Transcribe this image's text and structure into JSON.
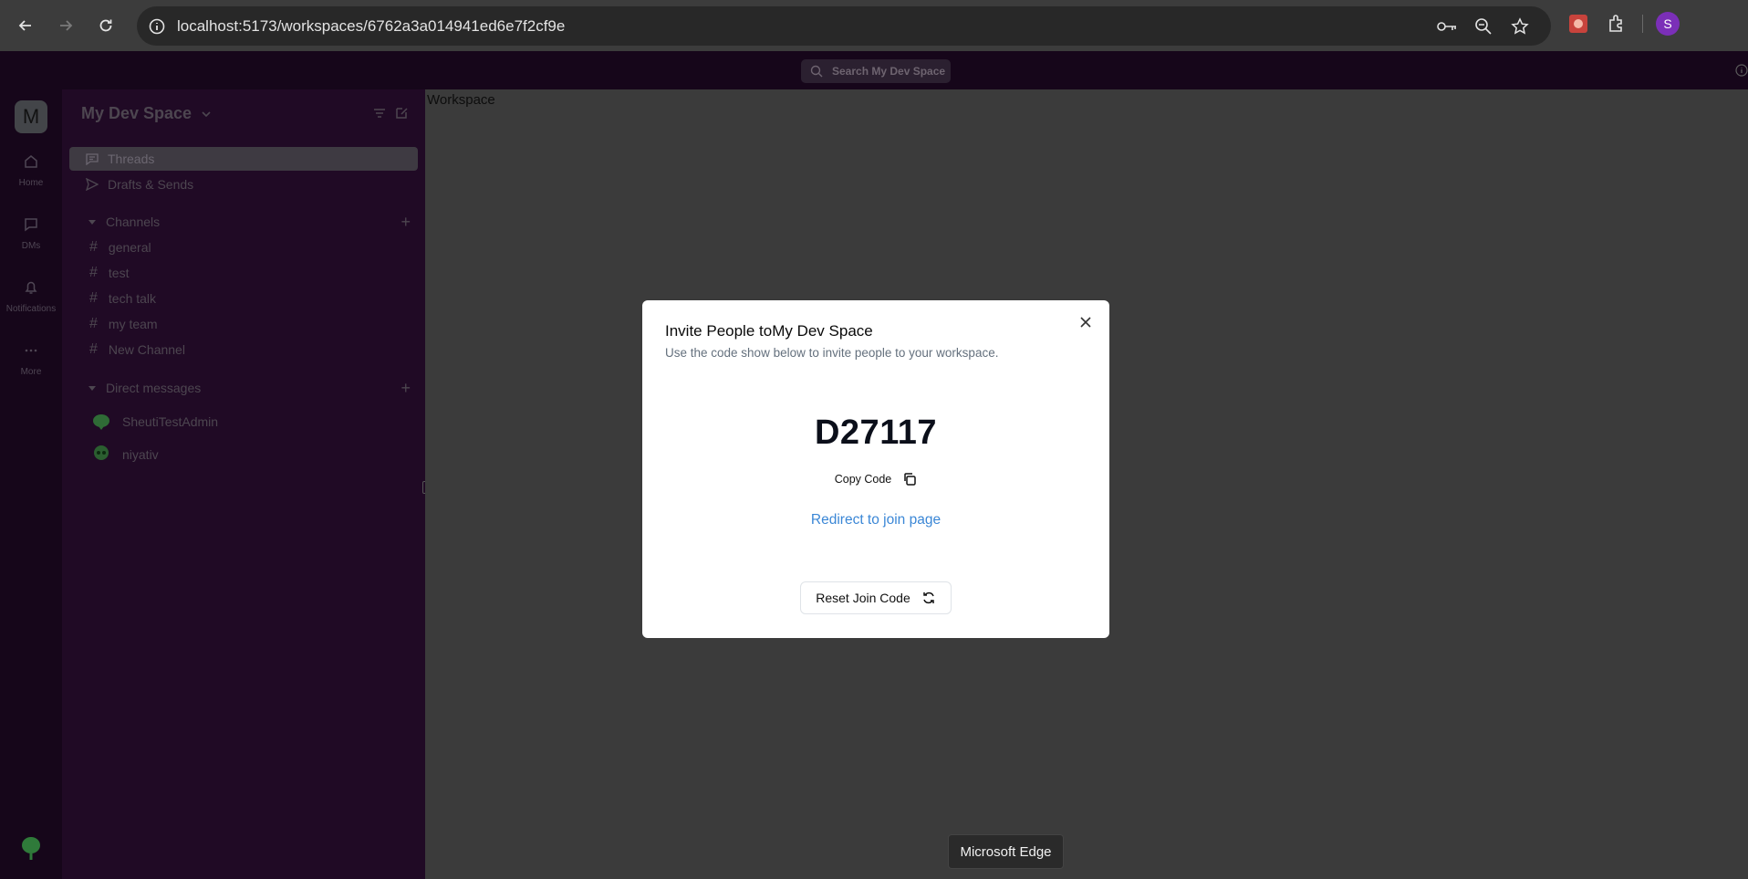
{
  "browser": {
    "url": "localhost:5173/workspaces/6762a3a014941ed6e7f2cf9e",
    "profile_initial": "S"
  },
  "app": {
    "search_placeholder": "Search My Dev Space"
  },
  "rail": {
    "workspace_initial": "M",
    "items": [
      {
        "label": "Home",
        "icon": "home-icon"
      },
      {
        "label": "DMs",
        "icon": "chat-icon"
      },
      {
        "label": "Notifications",
        "icon": "bell-icon"
      },
      {
        "label": "More",
        "icon": "more-icon"
      }
    ]
  },
  "sidebar": {
    "workspace_name": "My Dev Space",
    "items": [
      {
        "label": "Threads",
        "icon": "threads-icon"
      },
      {
        "label": "Drafts & Sends",
        "icon": "send-icon"
      }
    ],
    "channels_heading": "Channels",
    "channels": [
      "general",
      "test",
      "tech talk",
      "my team",
      "New Channel"
    ],
    "dms_heading": "Direct messages",
    "dms": [
      "SheutiTestAdmin",
      "niyativ"
    ]
  },
  "main": {
    "label": "Workspace"
  },
  "modal": {
    "title": "Invite People toMy Dev Space",
    "description": "Use the code show below to invite people to your workspace.",
    "code": "D27117",
    "copy_label": "Copy Code",
    "redirect_link": "Redirect to join page",
    "reset_label": "Reset Join Code"
  },
  "tooltip": {
    "text": "Microsoft Edge"
  }
}
